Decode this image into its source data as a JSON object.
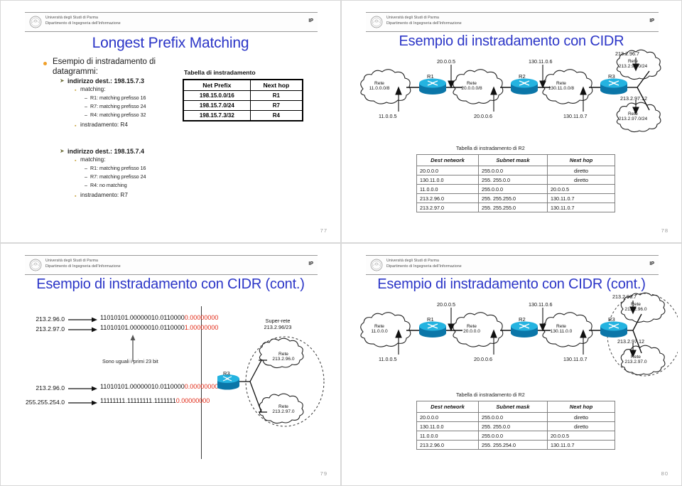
{
  "header": {
    "line1": "Università degli Studi di Parma",
    "line2": "Dipartimento di Ingegneria dell'Informazione",
    "right_tag": "IP",
    "logo_icon": "university-seal-icon"
  },
  "slides": [
    {
      "id": "slide-77",
      "page": "77",
      "title": "Longest Prefix Matching",
      "bullets": {
        "l1": "Esempio di instradamento di datagrammi:",
        "case1": {
          "heading": "indirizzo dest.: 198.15.7.3",
          "matching_label": "matching:",
          "items": [
            "R1: matching prefisso 16",
            "R7: matching prefisso 24",
            "R4: matching prefisso 32"
          ],
          "result": "instradamento: R4"
        },
        "case2": {
          "heading": "indirizzo dest.: 198.15.7.4",
          "matching_label": "matching:",
          "items": [
            "R1: matching prefisso 16",
            "R7: matching prefisso 24",
            "R4: no matching"
          ],
          "result": "instradamento: R7"
        }
      },
      "table": {
        "caption": "Tabella di instradamento",
        "columns": [
          "Net Prefix",
          "Next hop"
        ],
        "rows": [
          [
            "198.15.0.0/16",
            "R1"
          ],
          [
            "198.15.7.0/24",
            "R7"
          ],
          [
            "198.15.7.3/32",
            "R4"
          ]
        ]
      }
    },
    {
      "id": "slide-78",
      "page": "78",
      "title": "Esempio di instradamento con CIDR",
      "diagram": {
        "routers": [
          "R1",
          "R2",
          "R3"
        ],
        "clouds": [
          {
            "l1": "Rete",
            "l2": "11.0.0.0/8"
          },
          {
            "l1": "Rete",
            "l2": "20.0.0.0/8"
          },
          {
            "l1": "Rete",
            "l2": "130.11.0.0/8"
          },
          {
            "l1": "Rete",
            "l2": "213.2.96.0/24"
          },
          {
            "l1": "Rete",
            "l2": "213.2.97.0/24"
          }
        ],
        "interfaces_top": [
          "20.0.0.5",
          "130.11.0.6",
          "213.2.96.7"
        ],
        "interfaces_bottom": [
          "11.0.0.5",
          "20.0.0.6",
          "130.11.0.7"
        ],
        "interface_right": "213.2.97.12"
      },
      "table": {
        "caption": "Tabella di instradamento di R2",
        "columns": [
          "Dest network",
          "Subnet mask",
          "Next hop"
        ],
        "rows": [
          [
            "20.0.0.0",
            "255.0.0.0",
            "diretto"
          ],
          [
            "130.11.0.0",
            "255. 255.0.0",
            "diretto"
          ],
          [
            "11.0.0.0",
            "255.0.0.0",
            "20.0.0.5"
          ],
          [
            "213.2.96.0",
            "255. 255.255.0",
            "130.11.0.7"
          ],
          [
            "213.2.97.0",
            "255. 255.255.0",
            "130.11.0.7"
          ]
        ]
      }
    },
    {
      "id": "slide-79",
      "page": "79",
      "title": "Esempio di instradamento con CIDR (cont.)",
      "binary": {
        "top": [
          {
            "addr": "213.2.96.0",
            "black": "11010101.00000010.0110000",
            "red": "0.00000000"
          },
          {
            "addr": "213.2.97.0",
            "black": "11010101.00000010.0110000",
            "red": "1.00000000"
          }
        ],
        "bottom": [
          {
            "addr": "213.2.96.0",
            "black": "11010101.00000010.0110000",
            "red": "0.00000000"
          },
          {
            "addr": "255.255.254.0",
            "black": "11111111.11111111.1111111",
            "red": "0.00000000"
          }
        ],
        "note": "Sono uguali i primi 23 bit"
      },
      "supernet": {
        "label_line1": "Super-rete",
        "label_line2": "213.2.96/23",
        "router": "R3",
        "clouds": [
          {
            "l1": "Rete",
            "l2": "213.2.96.0"
          },
          {
            "l1": "Rete",
            "l2": "213.2.97.0"
          }
        ]
      }
    },
    {
      "id": "slide-80",
      "page": "80",
      "title": "Esempio di instradamento con CIDR (cont.)",
      "diagram": {
        "routers": [
          "R1",
          "R2",
          "R3"
        ],
        "clouds": [
          {
            "l1": "Rete",
            "l2": "11.0.0.0"
          },
          {
            "l1": "Rete",
            "l2": "20.0.0.0"
          },
          {
            "l1": "Rete",
            "l2": "130.11.0.0"
          },
          {
            "l1": "Rete",
            "l2": "213.2.96.0"
          },
          {
            "l1": "Rete",
            "l2": "213.2.97.0"
          }
        ],
        "interfaces_top": [
          "20.0.0.5",
          "130.11.0.6",
          "213.2.96.7"
        ],
        "interfaces_bottom": [
          "11.0.0.5",
          "20.0.0.6",
          "130.11.0.7"
        ],
        "interface_right": "213.2.97.12"
      },
      "table": {
        "caption": "Tabella di instradamento di R2",
        "columns": [
          "Dest network",
          "Subnet mask",
          "Next hop"
        ],
        "rows": [
          [
            "20.0.0.0",
            "255.0.0.0",
            "diretto"
          ],
          [
            "130.11.0.0",
            "255. 255.0.0",
            "diretto"
          ],
          [
            "11.0.0.0",
            "255.0.0.0",
            "20.0.0.5"
          ],
          [
            "213.2.96.0",
            "255. 255.254.0",
            "130.11.0.7"
          ]
        ]
      }
    }
  ],
  "colors": {
    "title_blue": "#2b35c7",
    "bullet_orange": "#f0a02a",
    "binary_red": "#e12b18",
    "router_blue": "#1aa3d8"
  }
}
